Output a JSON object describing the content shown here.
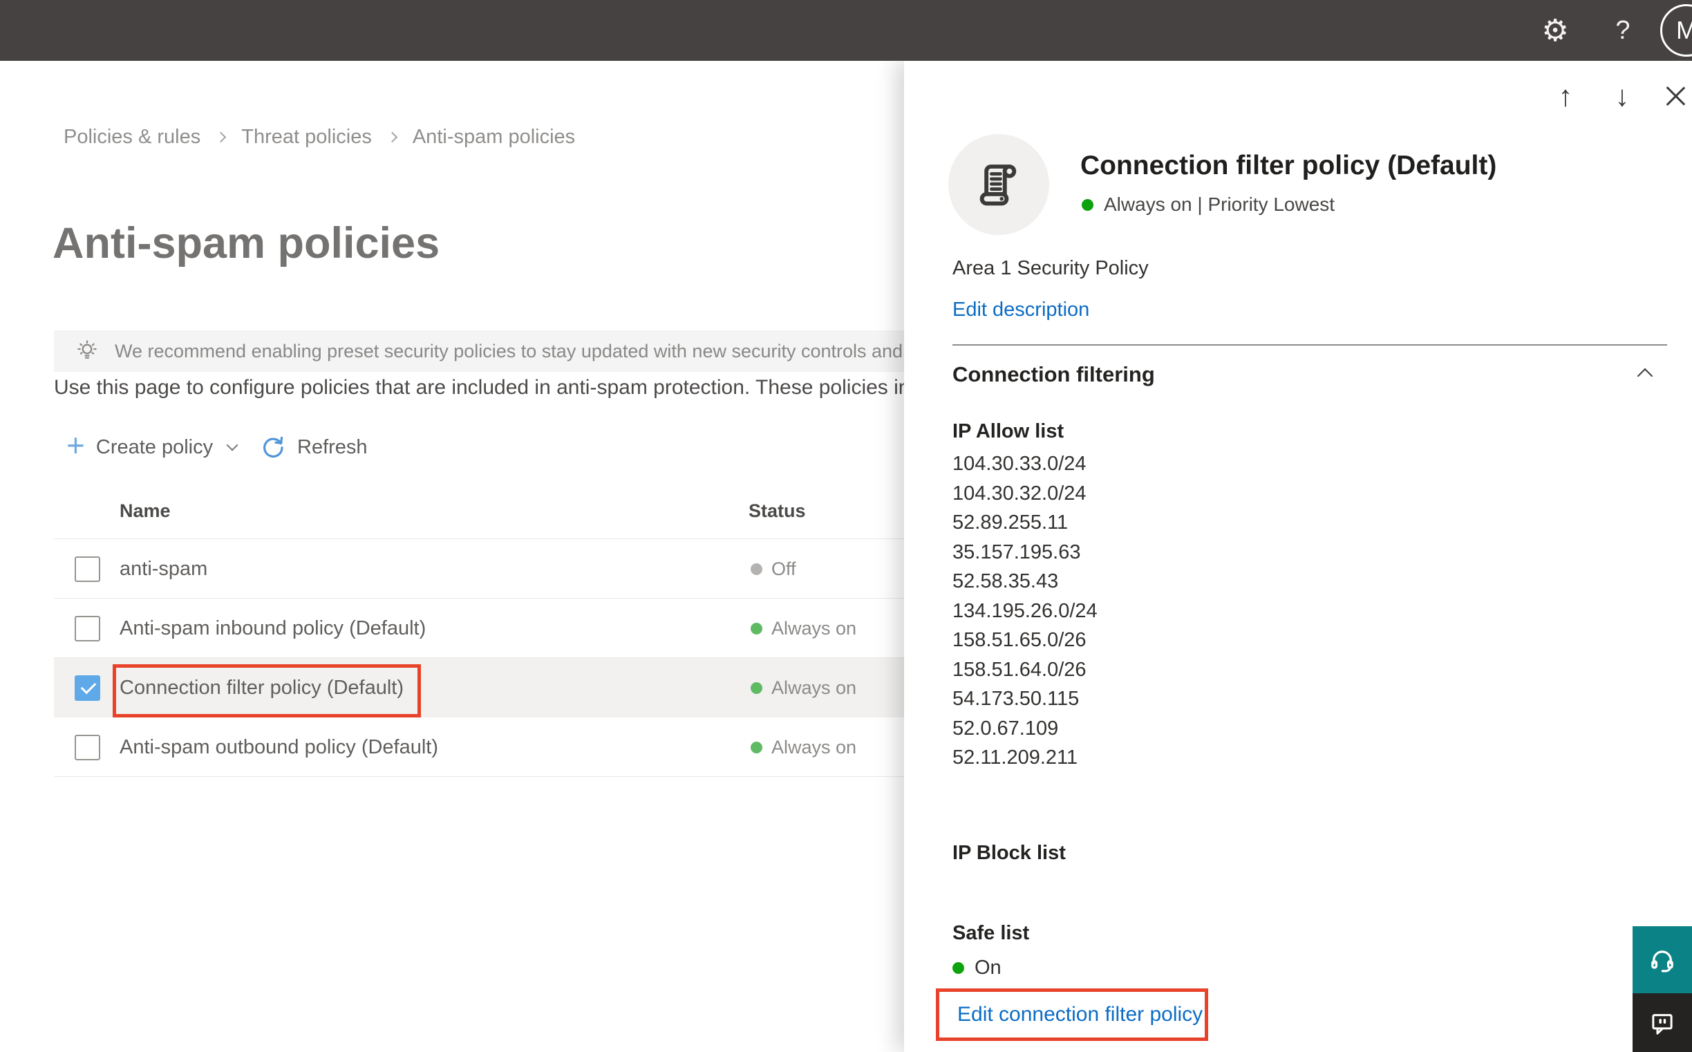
{
  "topbar": {
    "icons": {
      "gear": "⚙",
      "help": "?"
    },
    "avatar_initial": "M"
  },
  "breadcrumb": {
    "items": [
      "Policies & rules",
      "Threat policies",
      "Anti-spam policies"
    ]
  },
  "page": {
    "title": "Anti-spam policies",
    "banner_text": "We recommend enabling preset security policies to stay updated with new security controls and our recomme",
    "description": "Use this page to configure policies that are included in anti-spam protection. These policies include"
  },
  "toolbar": {
    "create_policy_label": "Create policy",
    "refresh_label": "Refresh"
  },
  "table": {
    "columns": {
      "name": "Name",
      "status": "Status"
    },
    "rows": [
      {
        "name": "anti-spam",
        "status": "Off",
        "state": "off",
        "checked": false
      },
      {
        "name": "Anti-spam inbound policy (Default)",
        "status": "Always on",
        "state": "on",
        "checked": false
      },
      {
        "name": "Connection filter policy (Default)",
        "status": "Always on",
        "state": "on",
        "checked": true,
        "selected": true,
        "annotated": true
      },
      {
        "name": "Anti-spam outbound policy (Default)",
        "status": "Always on",
        "state": "on",
        "checked": false
      }
    ]
  },
  "panel": {
    "icons": {
      "up": "↑",
      "down": "↓"
    },
    "title": "Connection filter policy (Default)",
    "status_line": "Always on | Priority Lowest",
    "description": "Area 1 Security Policy",
    "edit_description_label": "Edit description",
    "section_title": "Connection filtering",
    "ip_allow": {
      "title": "IP Allow list",
      "items": [
        "104.30.33.0/24",
        "104.30.32.0/24",
        "52.89.255.11",
        "35.157.195.63",
        "52.58.35.43",
        "134.195.26.0/24",
        "158.51.65.0/26",
        "158.51.64.0/26",
        "54.173.50.115",
        "52.0.67.109",
        "52.11.209.211"
      ]
    },
    "ip_block": {
      "title": "IP Block list"
    },
    "safe_list": {
      "title": "Safe list",
      "status": "On"
    },
    "edit_link_label": "Edit connection filter policy"
  },
  "floating_buttons": {
    "support_icon": "headset",
    "feedback_icon": "chat-bubble"
  },
  "colors": {
    "topbar_dark": "#454241",
    "accent_link_blue": "#0b6cc4",
    "status_on_green": "#5fbb63",
    "status_off_gray": "#b5b3b1",
    "panel_status_green": "#0ca30c",
    "annotation_red": "#e8432a",
    "checkbox_blue": "#5fa9e8",
    "support_teal": "#0b8386",
    "feedback_dark": "#252321"
  }
}
